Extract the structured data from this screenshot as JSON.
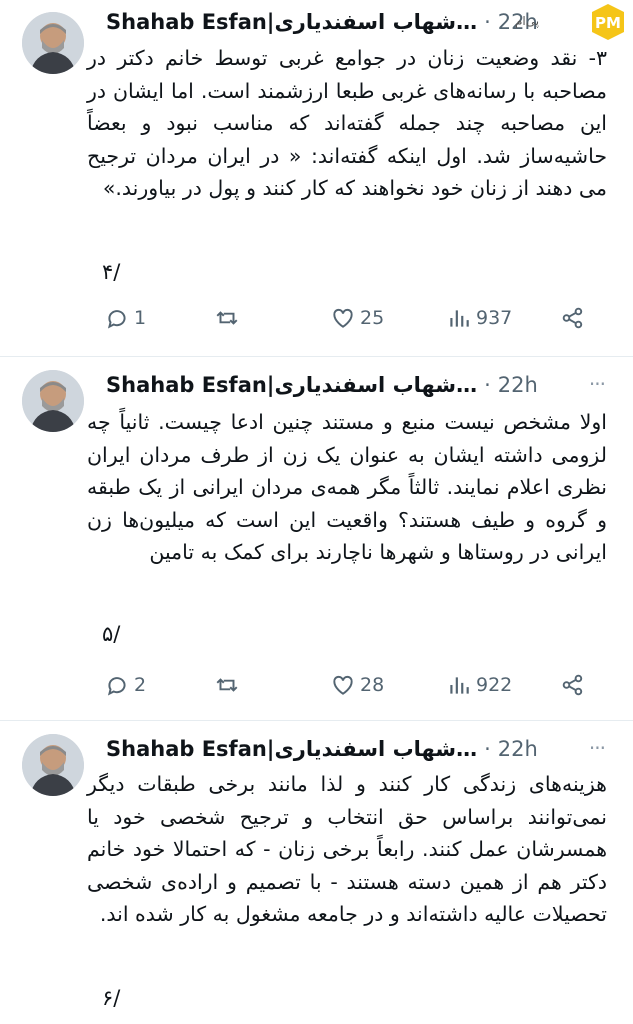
{
  "tweets": [
    {
      "name": "Shahab Esfan|شهاب اسفندیاری…",
      "time": "22h",
      "text": "۳- نقد وضعیت زنان در جوامع غربی توسط خانم دکتر در مصاحبه با رسانه‌های غربی طبعا ارزشمند است. اما ایشان در این مصاحبه چند جمله گفته‌اند که مناسب نبود و بعضاً حاشیه‌ساز شد. اول اینکه گفته‌اند: « در ایران مردان ترجیح می دهند از زنان خود نخواهند که کار کنند و پول در بیاورند.»",
      "page": "۴/",
      "replies": "1",
      "likes": "25",
      "views": "937"
    },
    {
      "name": "Shahab Esfan|شهاب اسفندیاری…",
      "time": "22h",
      "text": "اولا مشخص نیست منبع و مستند چنین ادعا چیست. ثانیاً چه لزومی داشته ایشان به عنوان یک زن از طرف مردان ایران نظری اعلام نمایند. ثالثاً مگر همه‌ی مردان ایرانی از یک طبقه و گروه و طیف هستند؟ واقعیت این است که میلیون‌ها زن ایرانی در روستاها و شهرها ناچارند برای کمک به تامین",
      "page": "۵/",
      "replies": "2",
      "likes": "28",
      "views": "922"
    },
    {
      "name": "Shahab Esfan|شهاب اسفندیاری…",
      "time": "22h",
      "text": "هزینه‌های زندگی کار کنند و لذا مانند برخی طبقات دیگر نمی‌توانند براساس حق انتخاب و ترجیح شخصی خود یا همسرشان عمل کنند. رابعاً برخی زنان - که احتمالا خود خانم دکتر هم از همین دسته هستند - با تصمیم و اراده‌ی شخصی تحصیلات عالیه داشته‌اند و در جامعه مشغول به کار شده اند.",
      "page": "۶/"
    }
  ],
  "watermark": {
    "text": "پی‌ام",
    "logo": "PM"
  },
  "colors": {
    "text": "#0f1419",
    "muted": "#536471",
    "divider": "#e6ecf0"
  },
  "icons": [
    "reply-icon",
    "retweet-icon",
    "like-icon",
    "views-icon",
    "share-icon",
    "more-icon"
  ]
}
